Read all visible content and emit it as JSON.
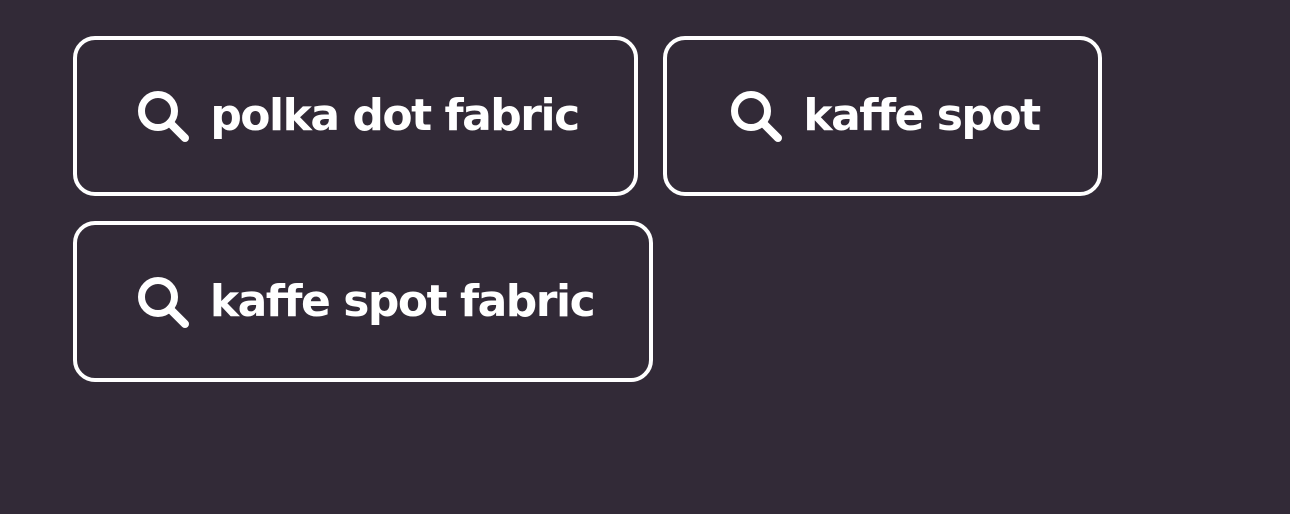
{
  "suggestions": [
    {
      "label": "polka dot fabric",
      "icon": "search-icon"
    },
    {
      "label": "kaffe spot",
      "icon": "search-icon"
    },
    {
      "label": "kaffe spot fabric",
      "icon": "search-icon"
    }
  ],
  "colors": {
    "background": "#322a37",
    "foreground": "#ffffff"
  }
}
